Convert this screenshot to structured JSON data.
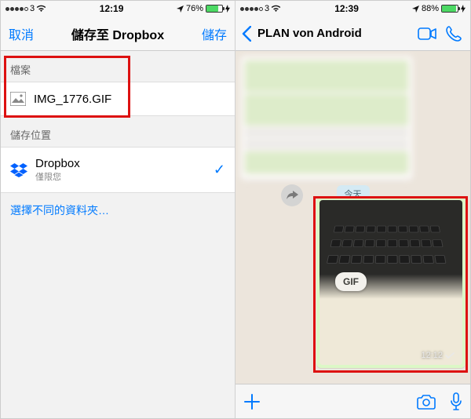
{
  "left": {
    "status": {
      "carrier": "3",
      "time": "12:19",
      "battery_pct": "76%",
      "battery_fill": 76
    },
    "nav": {
      "cancel": "取消",
      "title": "儲存至 Dropbox",
      "save": "儲存"
    },
    "file_section_label": "檔案",
    "file_name": "IMG_1776.GIF",
    "location_section_label": "儲存位置",
    "location_name": "Dropbox",
    "location_sub": "僅限您",
    "choose_folder": "選擇不同的資料夾…"
  },
  "right": {
    "status": {
      "carrier": "3",
      "time": "12:39",
      "battery_pct": "88%",
      "battery_fill": 88
    },
    "nav": {
      "title": "PLAN von Android"
    },
    "date_label": "今天",
    "gif_badge": "GIF",
    "msg_time": "12:12"
  }
}
